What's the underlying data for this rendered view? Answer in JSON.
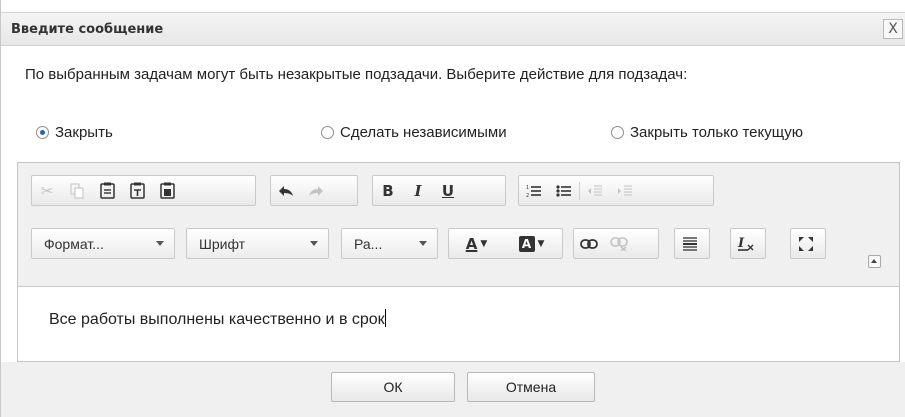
{
  "dialog": {
    "title": "Введите сообщение",
    "close_label": "X",
    "message": "По выбранным задачам могут быть незакрытые подзадачи. Выберите действие для подзадач:",
    "options": [
      {
        "label": "Закрыть",
        "checked": true
      },
      {
        "label": "Сделать независимыми",
        "checked": false
      },
      {
        "label": "Закрыть только текущую",
        "checked": false
      }
    ]
  },
  "toolbar": {
    "format_label": "Формат...",
    "font_label": "Шрифт",
    "size_label": "Ра...",
    "bold_label": "B",
    "italic_label": "I",
    "underline_label": "U",
    "text_color_label": "A",
    "bg_color_label": "A"
  },
  "editor": {
    "content": "Все работы выполнены качественно и в срок"
  },
  "footer": {
    "ok_label": "ОК",
    "cancel_label": "Отмена"
  },
  "colors": {
    "accent": "#2a62b3",
    "toolbar_bg": "#f0f0f0"
  }
}
